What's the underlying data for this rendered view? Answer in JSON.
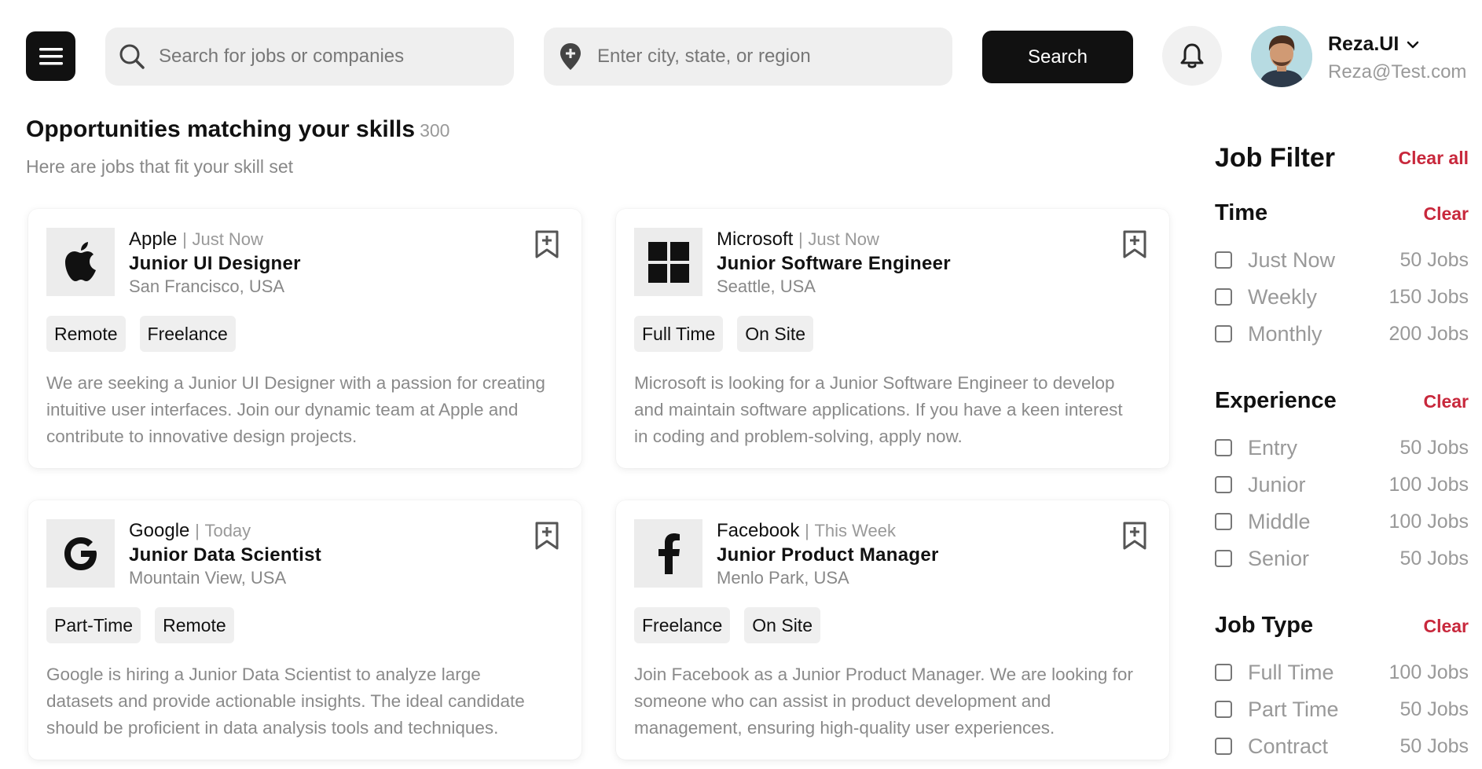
{
  "header": {
    "search_jobs_placeholder": "Search for jobs or companies",
    "search_location_placeholder": "Enter city, state, or region",
    "search_button": "Search",
    "user": {
      "name": "Reza.UI",
      "email": "Reza@Test.com"
    }
  },
  "main": {
    "title": "Opportunities matching your skills",
    "count": "300",
    "subtitle": "Here are jobs that fit your skill set",
    "jobs": [
      {
        "company": "Apple",
        "posted": "Just Now",
        "role": "Junior UI Designer",
        "location": "San Francisco, USA",
        "logo": "apple-logo-icon",
        "tags": [
          "Remote",
          "Freelance"
        ],
        "description": "We are seeking a Junior UI Designer with a passion for creating intuitive user interfaces. Join our dynamic team at Apple and contribute to innovative design projects."
      },
      {
        "company": "Microsoft",
        "posted": "Just Now",
        "role": "Junior Software Engineer",
        "location": "Seattle, USA",
        "logo": "windows-logo-icon",
        "tags": [
          "Full Time",
          "On Site"
        ],
        "description": "Microsoft is looking for a Junior Software Engineer to develop and maintain software applications. If you have a keen interest in coding and problem-solving, apply now."
      },
      {
        "company": "Google",
        "posted": "Today",
        "role": "Junior Data Scientist",
        "location": "Mountain View, USA",
        "logo": "google-logo-icon",
        "tags": [
          "Part-Time",
          "Remote"
        ],
        "description": "Google is hiring a Junior Data Scientist to analyze large datasets and provide actionable insights. The ideal candidate should be proficient in data analysis tools and techniques."
      },
      {
        "company": "Facebook",
        "posted": "This Week",
        "role": "Junior Product Manager",
        "location": "Menlo Park, USA",
        "logo": "facebook-logo-icon",
        "tags": [
          "Freelance",
          "On Site"
        ],
        "description": "Join Facebook as a Junior Product Manager. We are looking for someone who can assist in product development and management, ensuring high-quality user experiences."
      }
    ]
  },
  "filters": {
    "title": "Job Filter",
    "clear_all": "Clear all",
    "clear": "Clear",
    "sections": [
      {
        "title": "Time",
        "options": [
          {
            "label": "Just Now",
            "count": "50 Jobs"
          },
          {
            "label": "Weekly",
            "count": "150 Jobs"
          },
          {
            "label": "Monthly",
            "count": "200 Jobs"
          }
        ]
      },
      {
        "title": "Experience",
        "options": [
          {
            "label": "Entry",
            "count": "50 Jobs"
          },
          {
            "label": "Junior",
            "count": "100 Jobs"
          },
          {
            "label": "Middle",
            "count": "100 Jobs"
          },
          {
            "label": "Senior",
            "count": "50 Jobs"
          }
        ]
      },
      {
        "title": "Job Type",
        "options": [
          {
            "label": "Full Time",
            "count": "100 Jobs"
          },
          {
            "label": "Part Time",
            "count": "50 Jobs"
          },
          {
            "label": "Contract",
            "count": "50 Jobs"
          }
        ]
      }
    ]
  },
  "colors": {
    "accent": "#111111",
    "clear_link": "#c8283c",
    "muted_text": "#999999"
  }
}
